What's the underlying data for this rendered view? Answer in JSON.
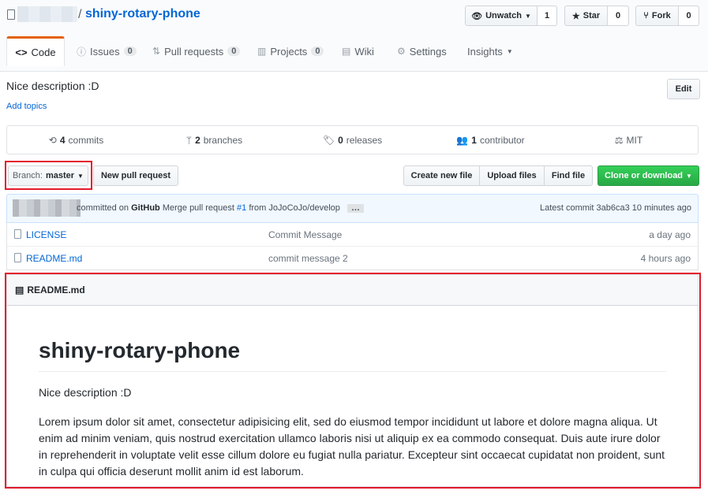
{
  "repo": {
    "name": "shiny-rotary-phone",
    "separator": "/"
  },
  "actions": {
    "unwatch_label": "Unwatch",
    "unwatch_count": "1",
    "star_label": "Star",
    "star_count": "0",
    "fork_label": "Fork",
    "fork_count": "0"
  },
  "tabs": [
    {
      "label": "Code"
    },
    {
      "label": "Issues",
      "count": "0"
    },
    {
      "label": "Pull requests",
      "count": "0"
    },
    {
      "label": "Projects",
      "count": "0"
    },
    {
      "label": "Wiki"
    },
    {
      "label": "Settings"
    },
    {
      "label": "Insights"
    }
  ],
  "description": "Nice description :D",
  "add_topics": "Add topics",
  "edit_label": "Edit",
  "summary": {
    "commits_num": "4",
    "commits_label": "commits",
    "branches_num": "2",
    "branches_label": "branches",
    "releases_num": "0",
    "releases_label": "releases",
    "contributors_num": "1",
    "contributors_label": "contributor",
    "license": "MIT"
  },
  "branch": {
    "prefix": "Branch:",
    "name": "master"
  },
  "buttons": {
    "new_pr": "New pull request",
    "create_file": "Create new file",
    "upload_files": "Upload files",
    "find_file": "Find file",
    "clone": "Clone or download"
  },
  "commit": {
    "text": "committed on",
    "author": "GitHub",
    "msg_prefix": "Merge pull request",
    "pr": "#1",
    "msg_suffix": "from JoJoCoJo/develop",
    "ellipsis": "…",
    "latest_prefix": "Latest commit",
    "sha": "3ab6ca3",
    "age": "10 minutes ago"
  },
  "files": [
    {
      "name": "LICENSE",
      "message": "Commit Message",
      "age": "a day ago"
    },
    {
      "name": "README.md",
      "message": "commit message 2",
      "age": "4 hours ago"
    }
  ],
  "readme": {
    "header": "README.md",
    "title": "shiny-rotary-phone",
    "para1": "Nice description :D",
    "para2": "Lorem ipsum dolor sit amet, consectetur adipisicing elit, sed do eiusmod tempor incididunt ut labore et dolore magna aliqua. Ut enim ad minim veniam, quis nostrud exercitation ullamco laboris nisi ut aliquip ex ea commodo consequat. Duis aute irure dolor in reprehenderit in voluptate velit esse cillum dolore eu fugiat nulla pariatur. Excepteur sint occaecat cupidatat non proident, sunt in culpa qui officia deserunt mollit anim id est laborum."
  },
  "colors": {
    "accent": "#0366d6",
    "highlight": "#e3192b",
    "clone_green": "#28a745",
    "tab_orange": "#e36209"
  }
}
